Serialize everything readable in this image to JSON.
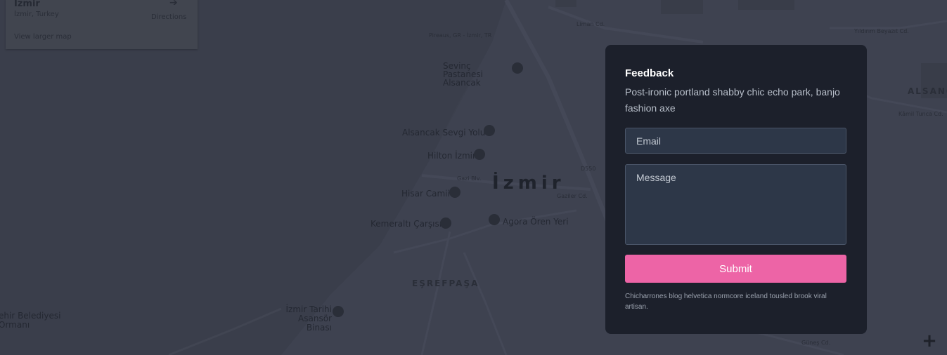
{
  "map": {
    "card": {
      "place": "İzmir",
      "address": "İzmir, Turkey",
      "directions_label": "Directions",
      "larger_map_link": "View larger map"
    },
    "city_label": "İzmir",
    "district_label": "EŞREFPAŞA",
    "area_right": "ALSANC",
    "poi": {
      "pireaus": "Pireaus, GR - İzmir, TR",
      "sevinc": "Sevinç Pastanesi Alsancak",
      "sevgi": "Alsancak Sevgi Yolu",
      "hilton": "Hilton İzmir",
      "hisar": "Hisar Camii",
      "kemeralti": "Kemeraltı Çarşısı",
      "agora": "Agora Ören Yeri",
      "asansor": "İzmir Tarihi Asansör Binası",
      "belediye": "ehir Belediyesi Ormanı"
    },
    "roads": {
      "liman": "Liman Cd.",
      "gazi": "Gazi Blv.",
      "gaziler": "Gaziler Cd.",
      "yildirim": "Yıldırım Beyazıt Cd.",
      "kamil": "Kâmil Tunca Cd.",
      "road_code": "D550",
      "sehit": "Şehit Fethi Bey Cd.",
      "sair": "Şair Eşref Blv.",
      "eref": "Eşrefpaşa Cd.",
      "gunes": "Güneş Cd."
    },
    "zoom_in_label": "+"
  },
  "feedback": {
    "title": "Feedback",
    "description": "Post-ironic portland shabby chic echo park, banjo fashion axe",
    "email_placeholder": "Email",
    "message_placeholder": "Message",
    "submit_label": "Submit",
    "footnote": "Chicharrones blog helvetica normcore iceland tousled brook viral artisan.",
    "accent_color": "#ed64a6"
  }
}
